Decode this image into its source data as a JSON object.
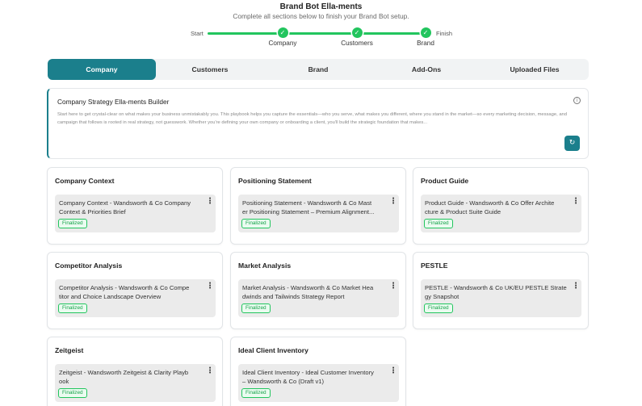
{
  "header": {
    "title": "Brand Bot Ella-ments",
    "subtitle": "Complete all sections below to finish your Brand Bot setup."
  },
  "progress": {
    "start_label": "Start",
    "finish_label": "Finish",
    "steps": [
      {
        "label": "Company",
        "status": "complete"
      },
      {
        "label": "Customers",
        "status": "complete"
      },
      {
        "label": "Brand",
        "status": "complete"
      }
    ],
    "check_glyph": "✓",
    "color": "#22c55e"
  },
  "tabs": [
    {
      "label": "Company",
      "active": true
    },
    {
      "label": "Customers",
      "active": false
    },
    {
      "label": "Brand",
      "active": false
    },
    {
      "label": "Add-Ons",
      "active": false
    },
    {
      "label": "Uploaded Files",
      "active": false
    }
  ],
  "builder": {
    "title": "Company Strategy Ella-ments Builder",
    "description": "Start here to get crystal-clear on what makes your business unmistakably you. This playbook helps you capture the essentials—who you serve, what makes you different, where you stand in the market—so every marketing decision, message, and campaign that follows is rooted in real strategy, not guesswork. Whether you're defining your own company or onboarding a client, you'll build the strategic foundation that makes...",
    "info_icon": "info-icon",
    "info_glyph": "i",
    "action_icon": "refresh-icon",
    "action_glyph": "↻"
  },
  "cards": [
    {
      "title": "Company Context",
      "doc": "Company Context - Wandsworth & Co Company\nContext & Priorities Brief",
      "badge": "Finalized"
    },
    {
      "title": "Positioning Statement",
      "doc": "Positioning Statement - Wandsworth & Co Mast\ner Positioning Statement – Premium Alignment...",
      "badge": "Finalized"
    },
    {
      "title": "Product Guide",
      "doc": "Product Guide - Wandsworth & Co Offer Archite\ncture & Product Suite Guide",
      "badge": "Finalized"
    },
    {
      "title": "Competitor Analysis",
      "doc": "Competitor Analysis - Wandsworth & Co Compe\ntitor and Choice Landscape Overview",
      "badge": "Finalized"
    },
    {
      "title": "Market Analysis",
      "doc": "Market Analysis - Wandsworth & Co Market Hea\ndwinds and Tailwinds Strategy Report",
      "badge": "Finalized"
    },
    {
      "title": "PESTLE",
      "doc": "PESTLE - Wandsworth & Co UK/EU PESTLE Strate\ngy Snapshot",
      "badge": "Finalized"
    },
    {
      "title": "Zeitgeist",
      "doc": "Zeitgeist - Wandsworth Zeitgeist & Clarity Playb\nook",
      "badge": "Finalized"
    },
    {
      "title": "Ideal Client Inventory",
      "doc": "Ideal Client Inventory - Ideal Customer Inventory\n– Wandsworth & Co (Draft v1)",
      "badge": "Finalized"
    }
  ],
  "menu_glyph": "⋮",
  "colors": {
    "accent": "#1b7f8c",
    "success": "#22c55e"
  }
}
